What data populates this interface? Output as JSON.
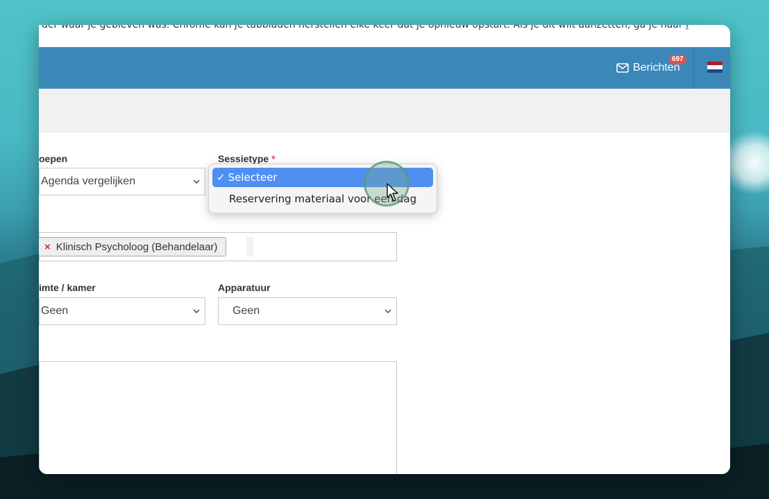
{
  "banner": {
    "text": "der waar je gebleven was. Chrome kan je tabbladen herstellen elke keer dat je opnieuw opstart. Als je dit wilt aanzetten, ga je naar ",
    "link": "I"
  },
  "topbar": {
    "messages_label": "Berichten",
    "messages_count": "697",
    "flag_colors": [
      "#ae1c28",
      "#ffffff",
      "#21468b"
    ]
  },
  "form": {
    "groups_label": "oepen",
    "groups_value": "Agenda vergelijken",
    "session_type_label": "Sessietype",
    "session_type_required": "*",
    "session_type_options": [
      {
        "label": "Selecteer",
        "selected": true
      },
      {
        "label": "Reservering materiaal voor een dag",
        "selected": false
      }
    ],
    "participant_tag": "Klinisch Psycholoog (Behandelaar)",
    "tag_remove": "×",
    "room_label": "imte / kamer",
    "room_value": "Geen",
    "equipment_label": "Apparatuur",
    "equipment_value": "Geen"
  },
  "colors": {
    "topbar": "#3a87b8",
    "selected_option": "#4f8ff1",
    "badge": "#d9534f"
  }
}
